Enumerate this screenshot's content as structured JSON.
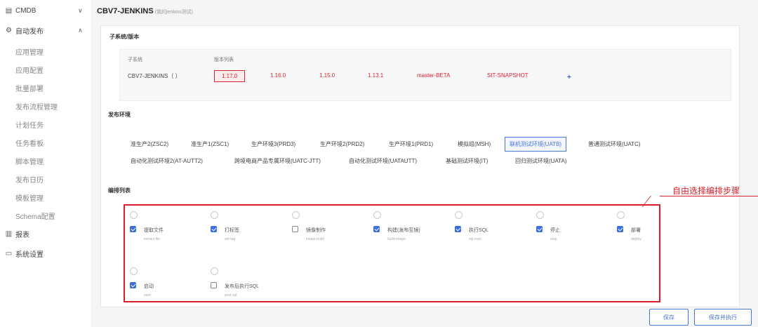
{
  "sidebar": {
    "items": [
      {
        "label": "CMDB",
        "icon": "database-icon",
        "chev": "∨"
      },
      {
        "label": "自动发布",
        "icon": "deploy-icon",
        "chev": "∧"
      },
      {
        "label": "报表",
        "icon": "report-icon"
      },
      {
        "label": "系统设置",
        "icon": "monitor-icon"
      }
    ],
    "sub_items": [
      "应用管理",
      "应用配置",
      "批量部署",
      "发布流程管理",
      "计划任务",
      "任务看板",
      "脚本管理",
      "发布日历",
      "模板管理",
      "Schema配置"
    ]
  },
  "header": {
    "title": "CBV7-JENKINS",
    "subtitle": "(我的jenkins测试)"
  },
  "subsystem": {
    "section_title": "子系统/版本",
    "col_subsystem": "子系统",
    "col_version": "版本列表",
    "name": "CBV7-JENKINS（ ）",
    "versions": [
      "1.17.0",
      "1.16.0",
      "1.15.0",
      "1.13.1",
      "master-BETA",
      "SIT-SNAPSHOT"
    ],
    "add": "+"
  },
  "env": {
    "section_title": "发布环境",
    "row1": [
      "准生产2(ZSC2)",
      "准生产1(ZSC1)",
      "生产环境3(PRD3)",
      "生产环境2(PRD2)",
      "生产环境1(PRD1)",
      "模拟组(MSH)",
      "联机测试环境(UATB)",
      "普通测试环境(UATC)"
    ],
    "row2": [
      "自动化测试环境2(AT-AUTT2)",
      "跨境电商产品专属环境(UATC-JTT)",
      "自动化测试环境(UATAUTT)",
      "基础测试环境(IT)",
      "回归测试环境(UATA)"
    ]
  },
  "steps": {
    "section_title": "编排列表",
    "items": [
      {
        "name": "提取文件",
        "sub": "extract-file",
        "checked": true
      },
      {
        "name": "打标签",
        "sub": "set-tag",
        "checked": true
      },
      {
        "name": "镜像制作",
        "sub": "image-build",
        "checked": false
      },
      {
        "name": "构建(发布至镜)",
        "sub": "build-image",
        "checked": true
      },
      {
        "name": "执行SQL",
        "sub": "sql-exec",
        "checked": true
      },
      {
        "name": "停止",
        "sub": "stop",
        "checked": true
      },
      {
        "name": "部署",
        "sub": "deploy",
        "checked": true
      },
      {
        "name": "启动",
        "sub": "start",
        "checked": true
      },
      {
        "name": "发布后执行SQL",
        "sub": "post-sql",
        "checked": false
      }
    ]
  },
  "annotation": "自由选择编排步骤",
  "buttons": {
    "save": "保存",
    "save_run": "保存并执行"
  },
  "colors": {
    "accent": "#4a76d4",
    "alert": "#d81e2a",
    "version": "#e0232e"
  }
}
